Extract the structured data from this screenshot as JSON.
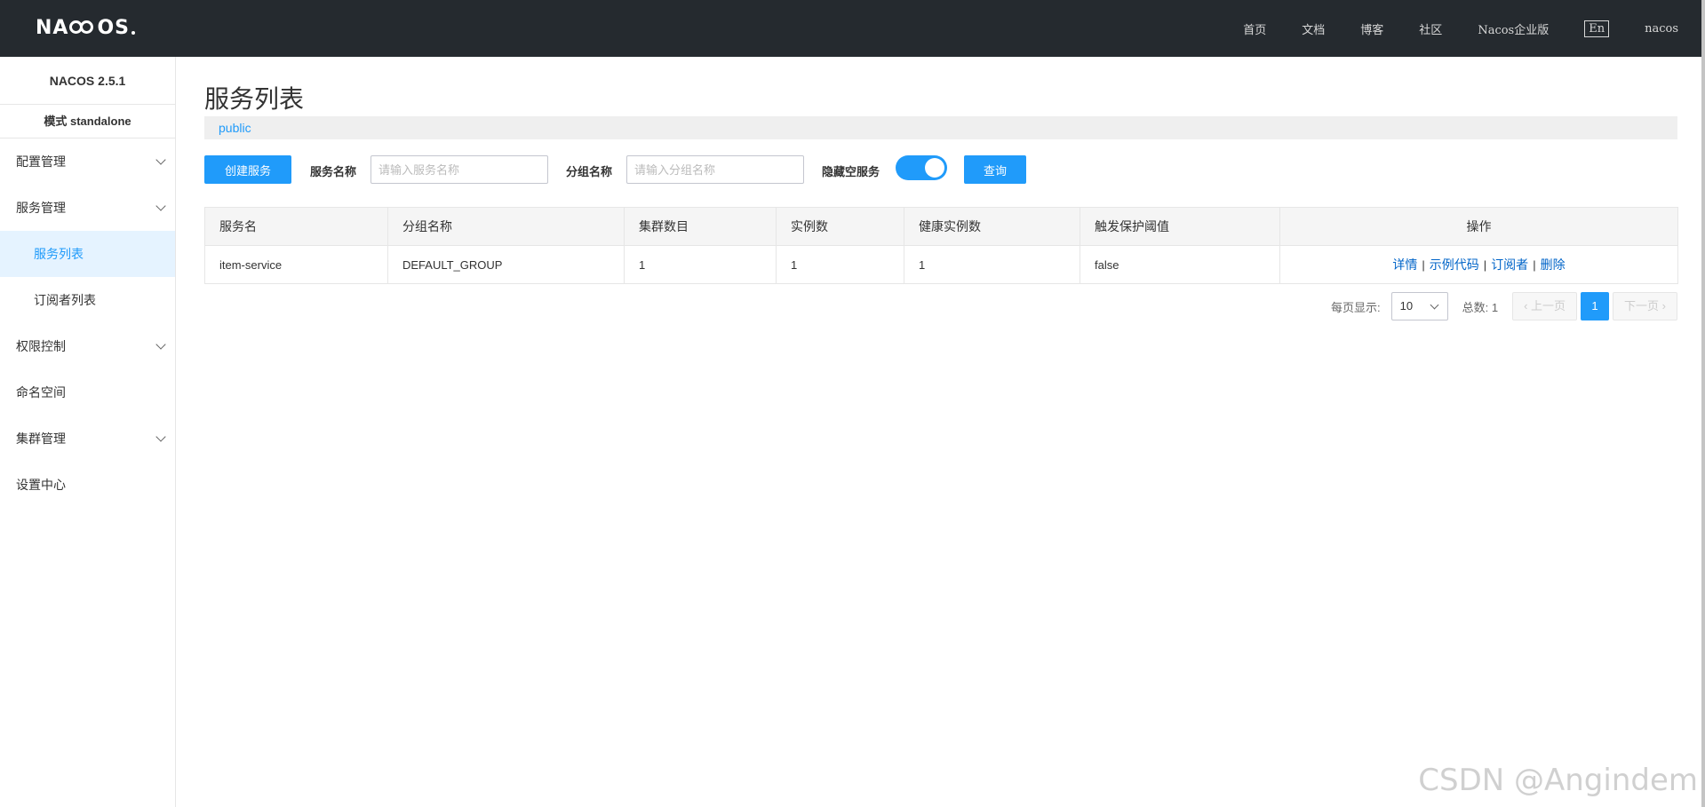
{
  "topbar": {
    "logo_left": "NA",
    "logo_right": "OS",
    "nav": [
      "首页",
      "文档",
      "博客",
      "社区",
      "Nacos企业版"
    ],
    "lang": "En",
    "user": "nacos"
  },
  "sidebar": {
    "version": "NACOS 2.5.1",
    "mode": "模式 standalone",
    "items": [
      {
        "label": "配置管理",
        "expandable": true
      },
      {
        "label": "服务管理",
        "expandable": true
      },
      {
        "label": "服务列表",
        "sub": true,
        "active": true
      },
      {
        "label": "订阅者列表",
        "sub": true
      },
      {
        "label": "权限控制",
        "expandable": true
      },
      {
        "label": "命名空间"
      },
      {
        "label": "集群管理",
        "expandable": true
      },
      {
        "label": "设置中心"
      }
    ]
  },
  "main": {
    "title": "服务列表",
    "namespace": "public",
    "toolbar": {
      "create_label": "创建服务",
      "service_name_label": "服务名称",
      "service_name_placeholder": "请输入服务名称",
      "group_name_label": "分组名称",
      "group_name_placeholder": "请输入分组名称",
      "hide_empty_label": "隐藏空服务",
      "hide_empty_on": true,
      "query_label": "查询"
    },
    "table": {
      "headers": [
        "服务名",
        "分组名称",
        "集群数目",
        "实例数",
        "健康实例数",
        "触发保护阈值",
        "操作"
      ],
      "rows": [
        {
          "name": "item-service",
          "group": "DEFAULT_GROUP",
          "clusters": "1",
          "instances": "1",
          "healthy": "1",
          "threshold": "false"
        }
      ],
      "ops": [
        "详情",
        "示例代码",
        "订阅者",
        "删除"
      ]
    },
    "pager": {
      "page_size_label": "每页显示:",
      "page_size": "10",
      "total_label": "总数: 1",
      "prev": "上一页",
      "current": "1",
      "next": "下一页"
    }
  },
  "watermark": "CSDN @Angindem",
  "colors": {
    "primary": "#209bfa",
    "topbar": "#252a2f",
    "link": "#0064c8"
  }
}
